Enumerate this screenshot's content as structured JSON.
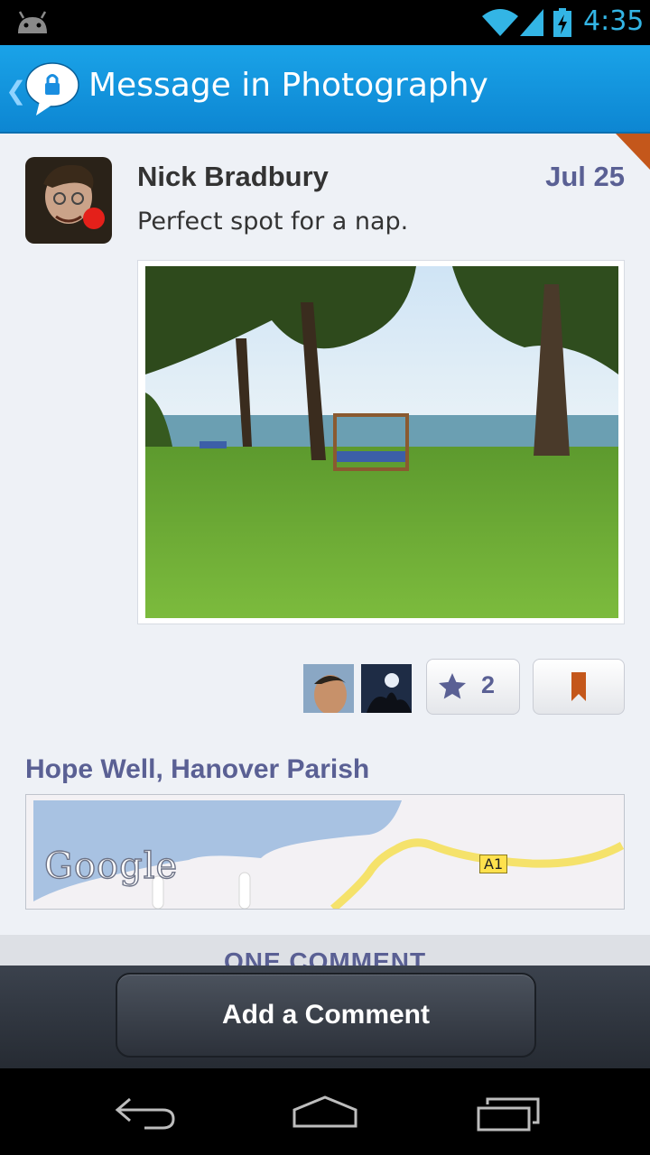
{
  "status_bar": {
    "time": "4:35"
  },
  "action_bar": {
    "title": "Message in Photography",
    "back": "❮"
  },
  "post": {
    "author": "Nick Bradbury",
    "date": "Jul 25",
    "message": "Perfect spot for a nap.",
    "star_count": "2",
    "location": "Hope Well, Hanover Parish",
    "map_provider": "Google",
    "road_label": "A1"
  },
  "comments": {
    "header": "ONE COMMENT"
  },
  "bottom_bar": {
    "add_comment": "Add a Comment"
  },
  "colors": {
    "accent": "#33b5e5",
    "action_bar": "#1599e0",
    "label_purple": "#5a6094",
    "bookmark": "#c4571b"
  }
}
